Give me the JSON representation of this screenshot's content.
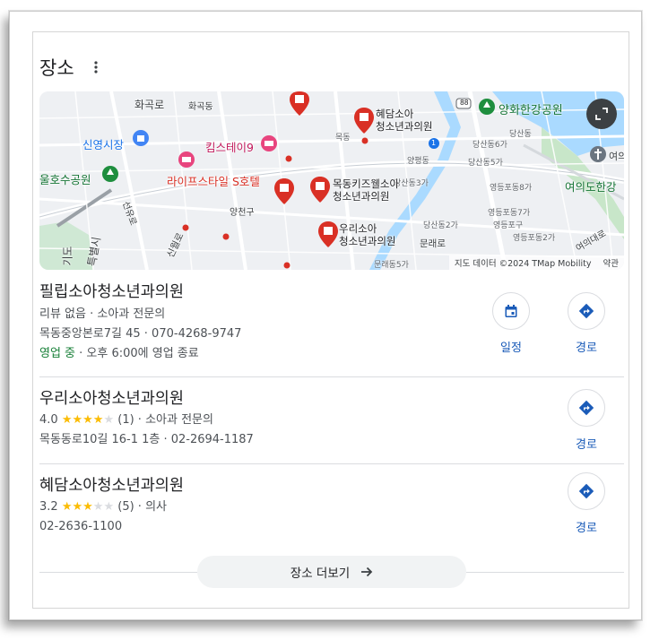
{
  "header": {
    "title": "장소"
  },
  "map": {
    "pins": [
      {
        "name": "혜담소아",
        "name2": "청소년과의원"
      },
      {
        "name": "목동키즈웰소아",
        "name2": "청소년과의원"
      },
      {
        "name": "우리소아",
        "name2": "청소년과의원"
      },
      {
        "name": "라이프스타일 S호텔"
      },
      {
        "name": "킴스테이9"
      }
    ],
    "labels": {
      "hwagok": "화곡로",
      "hwagokdong": "화곡동",
      "sinyeong": "신영시장",
      "yulhyeon": "울호수공원",
      "yangcheon": "양천구",
      "sinwol": "신월로",
      "mokdong": "목동",
      "yanghwa": "양화한강공원",
      "yeouido": "여의도한강",
      "yeoui": "여의",
      "dangsan1": "당산동",
      "dangsan6": "당산동6가",
      "dangsan5": "당산동5가",
      "dangsan3": "당산동3가",
      "dangsan2": "당산동2가",
      "yeongdeungpo": "영등포구",
      "mullae": "문래로",
      "mullaedong": "문래동5가",
      "yangpyeong": "양평동",
      "yeongdeungpo8": "영등포동8가",
      "yeongdeungpo2": "영등포동2가",
      "yeongdeungpo7": "영등포동7가",
      "yeouidaero": "여의대로",
      "gimpo": "기도",
      "tteukbyeol": "특별시",
      "seonyu": "선유로",
      "route88": "88",
      "route1": "1"
    },
    "attribution": "지도 데이터 ©2024 TMap Mobility",
    "terms": "약관"
  },
  "listings": [
    {
      "name": "필립소아청소년과의원",
      "meta": "리뷰 없음 · 소아과 전문의",
      "address": "목동중앙본로7길 45 · 070-4268-9747",
      "status_open": "영업 중",
      "status_rest": " · 오후 6:00에 영업 종료",
      "actions": {
        "schedule": "일정",
        "directions": "경로"
      }
    },
    {
      "name": "우리소아청소년과의원",
      "rating": "4.0",
      "stars_on": "★★★★",
      "stars_off": "★",
      "reviews": "(1)",
      "category": " · 소아과 전문의",
      "address": "목동동로10길 16-1 1층 · 02-2694-1187",
      "actions": {
        "directions": "경로"
      }
    },
    {
      "name": "혜담소아청소년과의원",
      "rating": "3.2",
      "stars_on": "★★★",
      "stars_off": "★★",
      "reviews": "(5)",
      "category": " · 의사",
      "phone": "02-2636-1100",
      "actions": {
        "directions": "경로"
      }
    }
  ],
  "more_button": {
    "label": "장소 더보기"
  },
  "colors": {
    "accent_blue": "#1a73e8",
    "open_green": "#188038",
    "star_yellow": "#fbbc04",
    "pin_red": "#d93025",
    "hotel_pink": "#e8457e"
  }
}
